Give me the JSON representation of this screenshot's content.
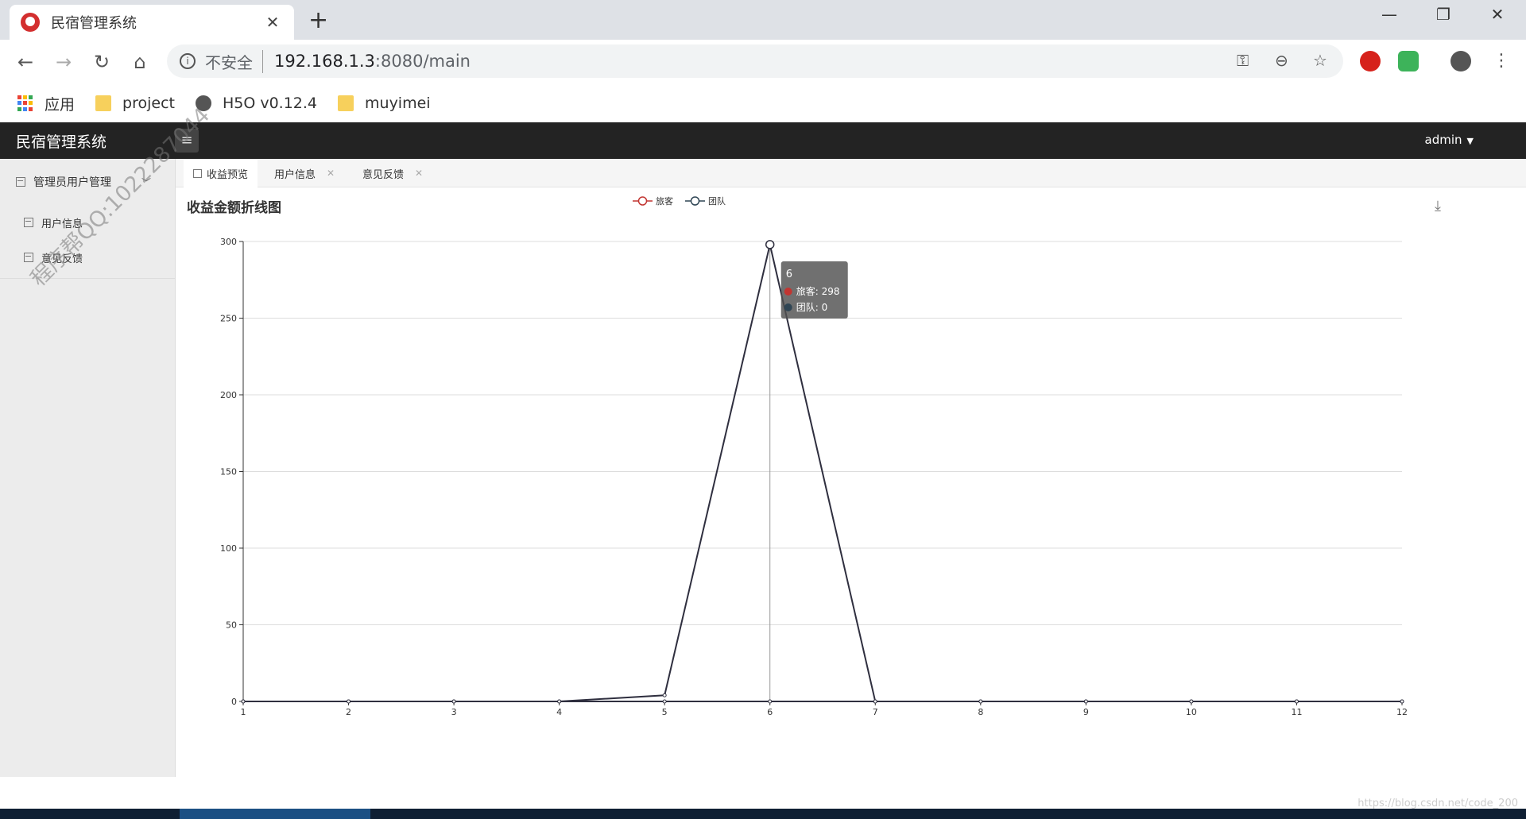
{
  "browser": {
    "tab_title": "民宿管理系统",
    "tab_close": "✕",
    "new_tab": "+",
    "security_label": "不安全",
    "url_host": "192.168.1.3",
    "url_rest": ":8080/main",
    "bookmarks": [
      {
        "label": "应用",
        "icon": "apps-icon"
      },
      {
        "label": "project",
        "icon": "folder-icon"
      },
      {
        "label": "H5O v0.12.4",
        "icon": "globe-icon"
      },
      {
        "label": "muyimei",
        "icon": "folder-icon"
      }
    ]
  },
  "app": {
    "brand": "民宿管理系统",
    "user": "admin",
    "sidebar": {
      "group_label": "管理员用户管理",
      "items": [
        {
          "label": "用户信息"
        },
        {
          "label": "意见反馈"
        }
      ]
    },
    "tabs": [
      {
        "label": "收益预览"
      },
      {
        "label": "用户信息"
      },
      {
        "label": "意见反馈"
      }
    ],
    "watermark": "程序帮QQ:1022287044",
    "footer_watermark": "https://blog.csdn.net/code_200"
  },
  "chart_data": {
    "type": "line",
    "title": "收益金额折线图",
    "x": [
      "1",
      "2",
      "3",
      "4",
      "5",
      "6",
      "7",
      "8",
      "9",
      "10",
      "11",
      "12"
    ],
    "ylim": [
      0,
      300
    ],
    "yticks": [
      0,
      50,
      100,
      150,
      200,
      250,
      300
    ],
    "grid": true,
    "legend_position": "top-center",
    "series": [
      {
        "name": "旅客",
        "values": [
          0,
          0,
          0,
          0,
          4,
          298,
          0,
          0,
          0,
          0,
          0,
          0
        ],
        "color": "#c23531"
      },
      {
        "name": "团队",
        "values": [
          0,
          0,
          0,
          0,
          0,
          0,
          0,
          0,
          0,
          0,
          0,
          0
        ],
        "color": "#2f4554"
      }
    ],
    "tooltip": {
      "x": "6",
      "lines": [
        "旅客: 298",
        "团队: 0"
      ]
    }
  }
}
